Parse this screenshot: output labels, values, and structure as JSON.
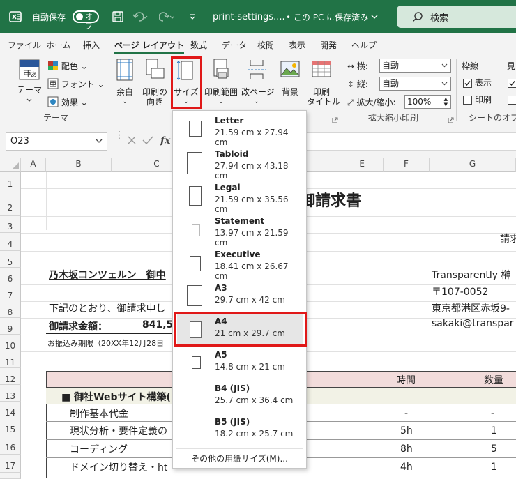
{
  "titlebar": {
    "autosave_label": "自動保存",
    "autosave_state": "オフ",
    "filename": "print-settings....",
    "save_location": "• この PC に保存済み",
    "search_placeholder": "検索"
  },
  "menu": [
    "ファイル",
    "ホーム",
    "挿入",
    "ページ レイアウト",
    "数式",
    "データ",
    "校閲",
    "表示",
    "開発",
    "ヘルプ"
  ],
  "ribbon": {
    "theme": "テーマ",
    "colors": "配色",
    "fonts": "フォント",
    "effects": "効果",
    "theme_group": "テーマ",
    "margins": "余白",
    "orientation_line1": "印刷の",
    "orientation_line2": "向き",
    "size": "サイズ",
    "print_area": "印刷範囲",
    "breaks": "改ページ",
    "background": "背景",
    "print_titles_line1": "印刷",
    "print_titles_line2": "タイトル",
    "width_label": "横:",
    "width_value": "自動",
    "height_label": "縦:",
    "height_value": "自動",
    "scale_label": "拡大/縮小:",
    "scale_value": "100%",
    "scale_group": "拡大縮小印刷",
    "gridlines": "枠線",
    "gridlines_view": "表示",
    "gridlines_print": "印刷",
    "sheet_options_group": "シートのオプシ",
    "headings_partial": "見"
  },
  "namebox": "O23",
  "columns": [
    "A",
    "B",
    "C",
    "E",
    "F",
    "G"
  ],
  "rows": [
    "1",
    "2",
    "3",
    "4",
    "5",
    "6",
    "7",
    "8",
    "9",
    "10",
    "11",
    "12",
    "13",
    "14",
    "15",
    "16",
    "17"
  ],
  "sheet": {
    "title": "御請求書",
    "invoice_partial": "請求",
    "client": "乃木坂コンツェルン　御中",
    "notice": "下記のとおり、御請求申し",
    "amount_label": "御請求金額：",
    "amount_value": "841,5",
    "due": "お振込み期限（20XX年12月28日",
    "company": "Transparently 榊",
    "zip": "〒107-0052",
    "address": "東京都港区赤坂9-",
    "email": "sakaki@transpar",
    "hdr_hours": "時間",
    "hdr_qty": "数量",
    "section": "■ 御社Webサイト構築(",
    "items": [
      {
        "name": "制作基本代金",
        "hours": "-",
        "qty": "-"
      },
      {
        "name": "現状分析・要件定義の",
        "hours": "5h",
        "qty": "1"
      },
      {
        "name": "コーディング",
        "hours": "8h",
        "qty": "5"
      },
      {
        "name": "ドメイン切り替え・ht",
        "hours": "4h",
        "qty": "1"
      }
    ]
  },
  "paper_sizes": [
    {
      "name": "Letter",
      "dims": "21.59 cm x 27.94 cm"
    },
    {
      "name": "Tabloid",
      "dims": "27.94 cm x 43.18 cm"
    },
    {
      "name": "Legal",
      "dims": "21.59 cm x 35.56 cm"
    },
    {
      "name": "Statement",
      "dims": "13.97 cm x 21.59 cm"
    },
    {
      "name": "Executive",
      "dims": "18.41 cm x 26.67 cm"
    },
    {
      "name": "A3",
      "dims": "29.7 cm x 42 cm"
    },
    {
      "name": "A4",
      "dims": "21 cm x 29.7 cm"
    },
    {
      "name": "A5",
      "dims": "14.8 cm x 21 cm"
    },
    {
      "name": "B4 (JIS)",
      "dims": "25.7 cm x 36.4 cm"
    },
    {
      "name": "B5 (JIS)",
      "dims": "18.2 cm x 25.7 cm"
    }
  ],
  "selected_paper": "A4",
  "more_sizes": "その他の用紙サイズ(M)...",
  "colors": {
    "accent": "#217346",
    "highlight": "#e01818",
    "table_header": "#f2dcdb",
    "section_row": "#f2f2e6"
  }
}
